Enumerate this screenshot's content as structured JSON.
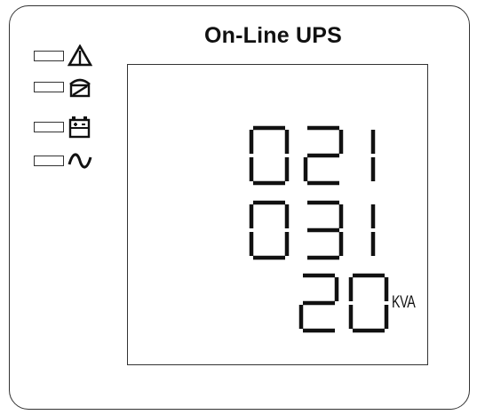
{
  "device": {
    "title": "On-Line UPS"
  },
  "indicators": [
    {
      "name": "fault",
      "icon": "warning-triangle-icon",
      "lit": false
    },
    {
      "name": "bypass",
      "icon": "bypass-icon",
      "lit": false
    },
    {
      "name": "battery",
      "icon": "battery-icon",
      "lit": false
    },
    {
      "name": "ac-line",
      "icon": "ac-sine-icon",
      "lit": false
    }
  ],
  "display": {
    "line1": "021",
    "line2": "031",
    "line3": "20",
    "unit": "KVA"
  },
  "colors": {
    "segment": "#111111",
    "frame": "#333333",
    "background": "#ffffff"
  }
}
